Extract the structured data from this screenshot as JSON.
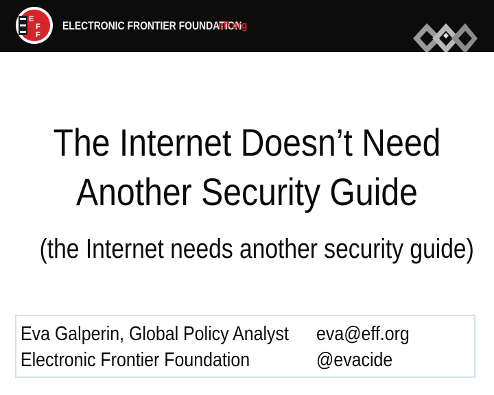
{
  "header": {
    "org_name": "ELECTRONIC FRONTIER FOUNDATION",
    "org_url": "eff.org",
    "logo_letters": [
      "E",
      "F",
      "F"
    ]
  },
  "slide": {
    "title_line1": "The Internet Doesn’t Need",
    "title_line2": "Another Security Guide",
    "subtitle": "(the Internet needs another security guide)"
  },
  "speaker": {
    "name_title": "Eva Galperin, Global Policy Analyst",
    "organization": "Electronic Frontier Foundation",
    "email": "eva@eff.org",
    "handle": "@evacide"
  },
  "colors": {
    "header_bg": "#0c0c0c",
    "eff_red": "#d6252a",
    "box_border": "#cfe4e8"
  }
}
